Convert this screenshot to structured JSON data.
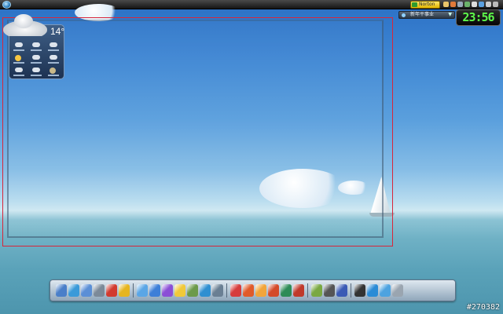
{
  "topbar": {
    "start_orb_icon": "windows-orb-icon",
    "norton_label": "Norton",
    "tray_icons": [
      "shield-icon",
      "globe-icon",
      "speaker-icon",
      "network-icon",
      "battery-icon",
      "chat-icon",
      "arrow-icon",
      "gear-icon"
    ]
  },
  "subbar": {
    "label": "新年干事业",
    "chevron": "▼"
  },
  "clock": {
    "time": "23:56"
  },
  "weather": {
    "temperature": "14°",
    "icon": "cloudy-rain-icon"
  },
  "dock": {
    "icons": [
      "computer-icon",
      "ie-icon",
      "globe-icon",
      "panel-icon",
      "record-icon",
      "gold-icon",
      "sep",
      "network-people-icon",
      "media-player-icon",
      "purple-app-icon",
      "notes-icon",
      "eye-icon",
      "calendar-icon",
      "tools-icon",
      "sep",
      "acrobat-icon",
      "grid-icon",
      "pen-icon",
      "browser-icon",
      "flag-icon",
      "shield-app-icon",
      "sep",
      "vgx-icon",
      "disc-icon",
      "h-icon",
      "sep",
      "clock-app-icon",
      "refresh-icon",
      "sync-icon",
      "trash-icon"
    ]
  },
  "watermark": "#270382"
}
